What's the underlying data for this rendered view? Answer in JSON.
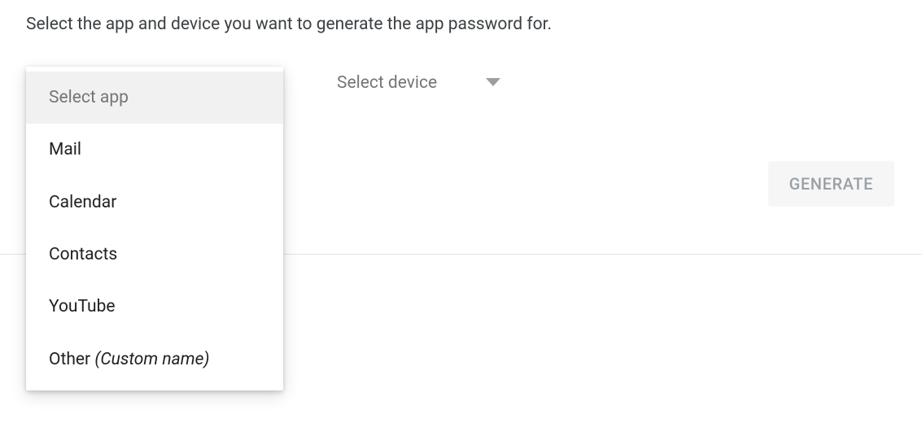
{
  "instruction": "Select the app and device you want to generate the app password for.",
  "app_dropdown": {
    "placeholder": "Select app",
    "options": [
      {
        "label": "Mail"
      },
      {
        "label": "Calendar"
      },
      {
        "label": "Contacts"
      },
      {
        "label": "YouTube"
      },
      {
        "label": "Other ",
        "suffix_italic": "(Custom name)"
      }
    ]
  },
  "device_dropdown": {
    "placeholder": "Select device"
  },
  "generate_button": {
    "label": "GENERATE"
  }
}
